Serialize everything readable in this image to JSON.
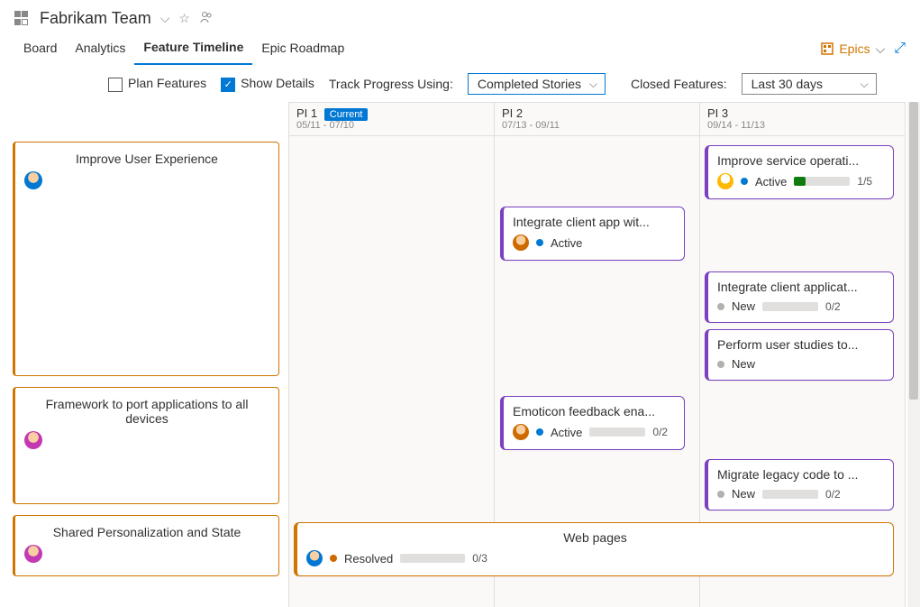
{
  "header": {
    "team_name": "Fabrikam Team"
  },
  "tabs": {
    "items": [
      "Board",
      "Analytics",
      "Feature Timeline",
      "Epic Roadmap"
    ],
    "active_index": 2,
    "right": {
      "epics_label": "Epics"
    }
  },
  "toolbar": {
    "plan_features_label": "Plan Features",
    "plan_features_checked": false,
    "show_details_label": "Show Details",
    "show_details_checked": true,
    "track_label": "Track Progress Using:",
    "track_value": "Completed Stories",
    "closed_label": "Closed Features:",
    "closed_value": "Last 30 days"
  },
  "columns": [
    {
      "name": "PI 1",
      "badge": "Current",
      "dates": "05/11 - 07/10"
    },
    {
      "name": "PI 2",
      "badge": "",
      "dates": "07/13 - 09/11"
    },
    {
      "name": "PI 3",
      "badge": "",
      "dates": "09/14 - 11/13"
    }
  ],
  "epics": [
    {
      "title": "Improve User Experience",
      "avatar": "a5"
    },
    {
      "title": "Framework to port applications to all devices",
      "avatar": "a2"
    },
    {
      "title": "Shared Personalization and State",
      "avatar": "a2"
    }
  ],
  "cards": {
    "c1": {
      "title": "Integrate client app wit...",
      "state": "Active",
      "dot": "blue",
      "avatar": "a3",
      "progress": null
    },
    "c2": {
      "title": "Improve service operati...",
      "state": "Active",
      "dot": "blue",
      "avatar": "a4",
      "progress": {
        "done": 1,
        "total": 5,
        "text": "1/5"
      }
    },
    "c3": {
      "title": "Integrate client applicat...",
      "state": "New",
      "dot": "grey",
      "avatar": "",
      "progress": {
        "done": 0,
        "total": 2,
        "text": "0/2"
      }
    },
    "c4": {
      "title": "Perform user studies to...",
      "state": "New",
      "dot": "grey",
      "avatar": "",
      "progress": null
    },
    "c5": {
      "title": "Emoticon feedback ena...",
      "state": "Active",
      "dot": "blue",
      "avatar": "a3",
      "progress": {
        "done": 0,
        "total": 2,
        "text": "0/2"
      }
    },
    "c6": {
      "title": "Migrate legacy code to ...",
      "state": "New",
      "dot": "grey",
      "avatar": "",
      "progress": {
        "done": 0,
        "total": 2,
        "text": "0/2"
      }
    },
    "c7": {
      "title": "Web pages",
      "state": "Resolved",
      "dot": "gold",
      "avatar": "a5",
      "progress": {
        "done": 0,
        "total": 3,
        "text": "0/3"
      }
    }
  }
}
